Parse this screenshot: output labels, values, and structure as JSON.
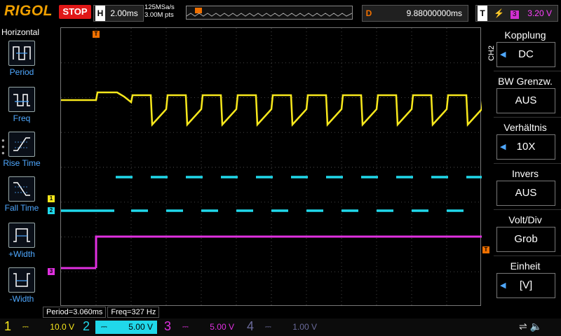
{
  "topbar": {
    "brand": "RIGOL",
    "run_state": "STOP",
    "timebase_label": "H",
    "timebase_value": "2.00ms",
    "sample_rate": "125MSa/s",
    "memory_points": "3.00M pts",
    "delay_label": "D",
    "delay_value": "9.88000000ms",
    "trigger_label": "T",
    "trigger_source": "3",
    "trigger_level": "3.20 V"
  },
  "leftmenu": {
    "title": "Horizontal",
    "items": [
      {
        "label": "Period",
        "icon": "period-icon"
      },
      {
        "label": "Freq",
        "icon": "freq-icon"
      },
      {
        "label": "Rise Time",
        "icon": "rise-time-icon"
      },
      {
        "label": "Fall Time",
        "icon": "fall-time-icon"
      },
      {
        "label": "+Width",
        "icon": "positive-width-icon"
      },
      {
        "label": "-Width",
        "icon": "negative-width-icon"
      }
    ]
  },
  "rightmenu": {
    "channel": "CH2",
    "items": [
      {
        "title": "Kopplung",
        "value": "DC"
      },
      {
        "title": "BW Grenzw.",
        "value": "AUS"
      },
      {
        "title": "Verhältnis",
        "value": "10X"
      },
      {
        "title": "Invers",
        "value": "AUS"
      },
      {
        "title": "Volt/Div",
        "value": "Grob"
      },
      {
        "title": "Einheit",
        "value": "[V]"
      }
    ]
  },
  "measurements": {
    "period": "Period=3.060ms",
    "freq": "Freq=327 Hz"
  },
  "channels": [
    {
      "num": "1",
      "scale": "10.0 V",
      "color": "#f8e81c"
    },
    {
      "num": "2",
      "scale": "5.00 V",
      "color": "#20d8ea"
    },
    {
      "num": "3",
      "scale": "5.00 V",
      "color": "#e030e0"
    },
    {
      "num": "4",
      "scale": "1.00 V",
      "color": "#6a6a9a"
    }
  ],
  "markers": {
    "trigger_top": "T",
    "trigger_right": "T",
    "ch1": "1",
    "ch2": "2",
    "ch3": "3"
  }
}
